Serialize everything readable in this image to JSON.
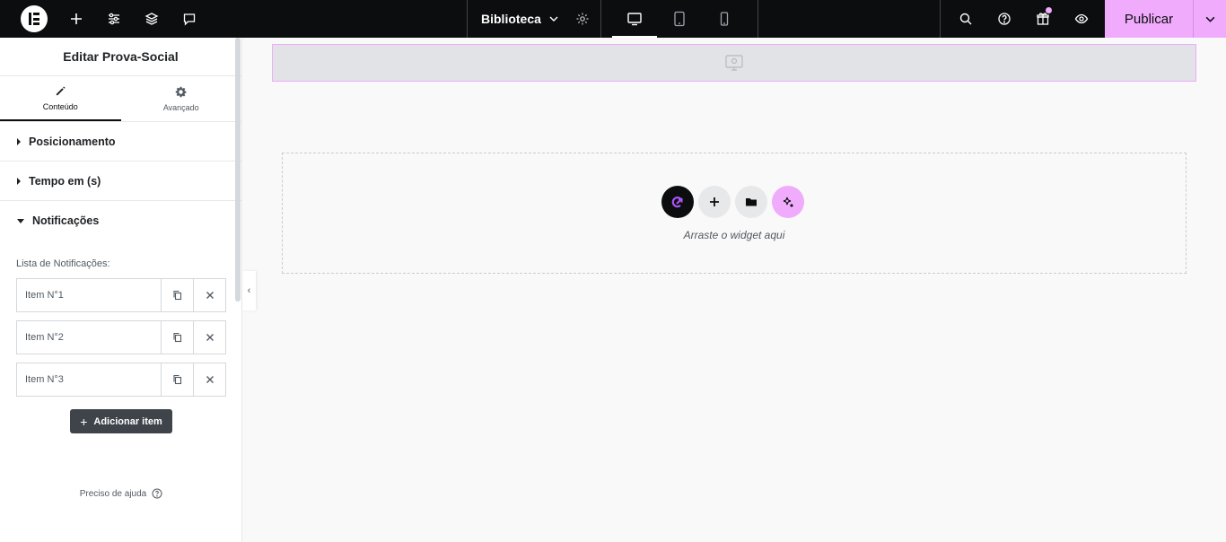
{
  "topbar": {
    "logo_icon": "elementor-logo-icon",
    "left_icons": [
      "plus-icon",
      "sliders-icon",
      "layers-icon",
      "comment-icon"
    ],
    "library_label": "Biblioteca",
    "devices": [
      "desktop-icon",
      "tablet-icon",
      "mobile-icon"
    ],
    "active_device": "desktop",
    "right_icons": [
      "search-icon",
      "help-icon",
      "gift-icon",
      "eye-icon"
    ],
    "publish_label": "Publicar",
    "accent_color": "#f0abfc"
  },
  "panel": {
    "title": "Editar Prova-Social",
    "tabs": [
      {
        "label": "Conteúdo",
        "icon": "pencil-icon"
      },
      {
        "label": "Avançado",
        "icon": "gear-icon"
      }
    ],
    "sections": [
      {
        "label": "Posicionamento",
        "open": false
      },
      {
        "label": "Tempo em (s)",
        "open": false
      },
      {
        "label": "Notificações",
        "open": true
      }
    ],
    "list_label": "Lista de Notificações:",
    "items": [
      {
        "label": "Item N°1"
      },
      {
        "label": "Item N°2"
      },
      {
        "label": "Item N°3"
      }
    ],
    "add_label": "Adicionar item",
    "help_label": "Preciso de ajuda"
  },
  "canvas": {
    "dropzone_text": "Arraste o widget aqui"
  }
}
